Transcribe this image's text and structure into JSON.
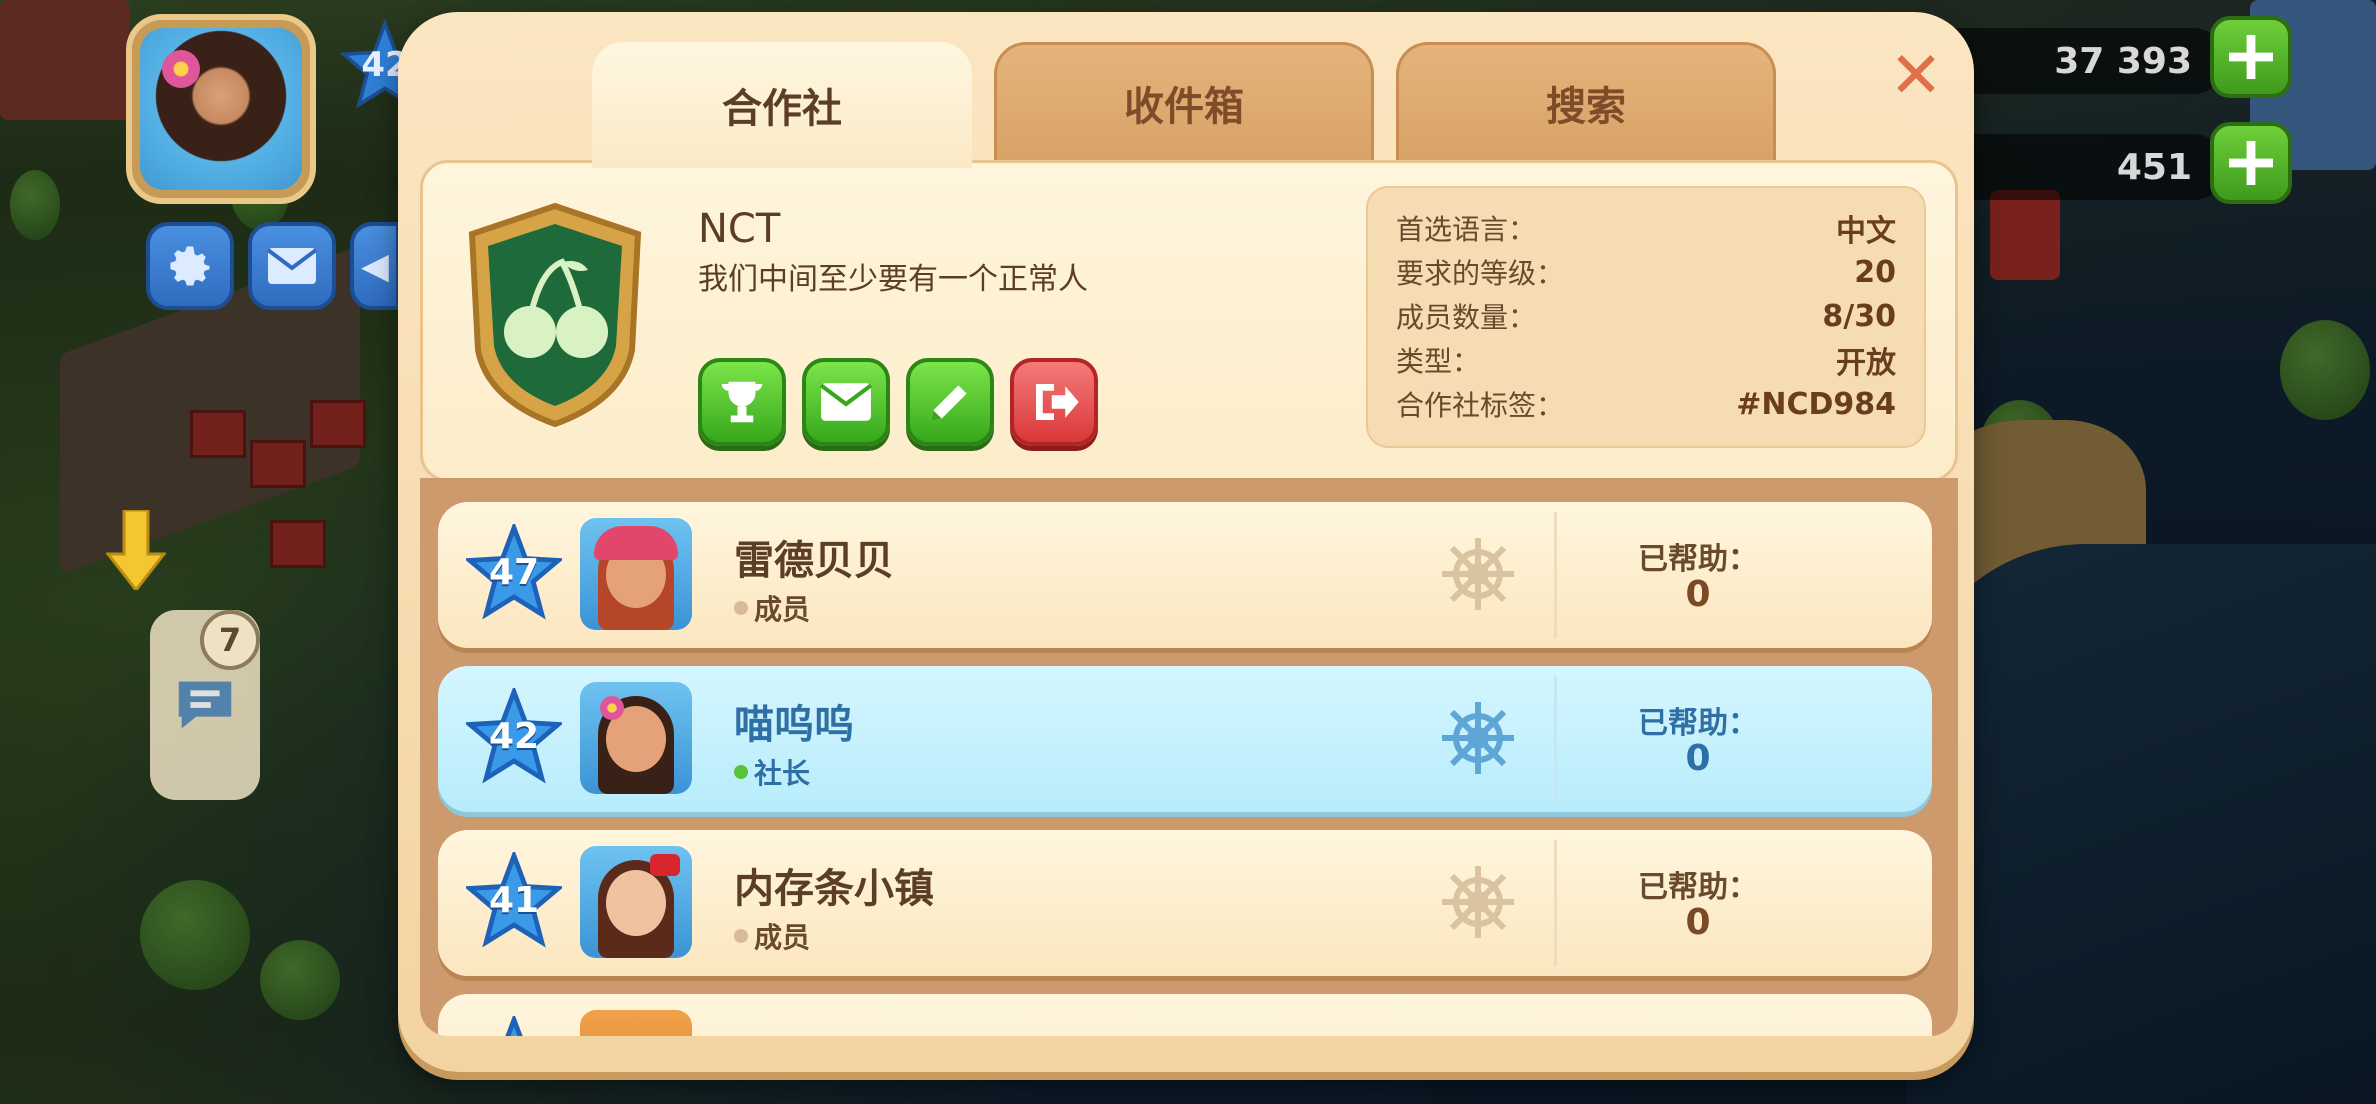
{
  "hud": {
    "player_level": "42",
    "chat_badge_count": "7",
    "coins": "37 393",
    "cash": "451"
  },
  "dialog": {
    "tabs": [
      "合作社",
      "收件箱",
      "搜索"
    ],
    "active_tab": "合作社",
    "close_label": "✕"
  },
  "club": {
    "name": "NCT",
    "description": "我们中间至少要有一个正常人",
    "emblem_icon": "cherry-shield-icon",
    "actions": [
      {
        "name": "trophy",
        "icon": "trophy-icon"
      },
      {
        "name": "mail",
        "icon": "mail-icon"
      },
      {
        "name": "edit",
        "icon": "pencil-icon"
      },
      {
        "name": "leave",
        "icon": "exit-icon"
      }
    ],
    "stats": [
      {
        "label": "首选语言：",
        "value": "中文"
      },
      {
        "label": "要求的等级：",
        "value": "20"
      },
      {
        "label": "成员数量：",
        "value": "8/30"
      },
      {
        "label": "类型：",
        "value": "开放"
      },
      {
        "label": "合作社标签：",
        "value": "#NCD984"
      }
    ]
  },
  "members": [
    {
      "level": "47",
      "name": "雷德贝贝",
      "role": "成员",
      "helped_label": "已帮助：",
      "helped": "0",
      "is_leader": false,
      "avatar": "redhead-cap-avatar"
    },
    {
      "level": "42",
      "name": "喵呜呜",
      "role": "社长",
      "helped_label": "已帮助：",
      "helped": "0",
      "is_leader": true,
      "avatar": "braided-girl-avatar"
    },
    {
      "level": "41",
      "name": "内存条小镇",
      "role": "成员",
      "helped_label": "已帮助：",
      "helped": "0",
      "is_leader": false,
      "avatar": "bow-girl-avatar"
    }
  ],
  "colors": {
    "accent_green": "#37a81c",
    "accent_red": "#d93838",
    "leader_highlight": "#b8ecfb",
    "panel": "#fbe6c2"
  }
}
